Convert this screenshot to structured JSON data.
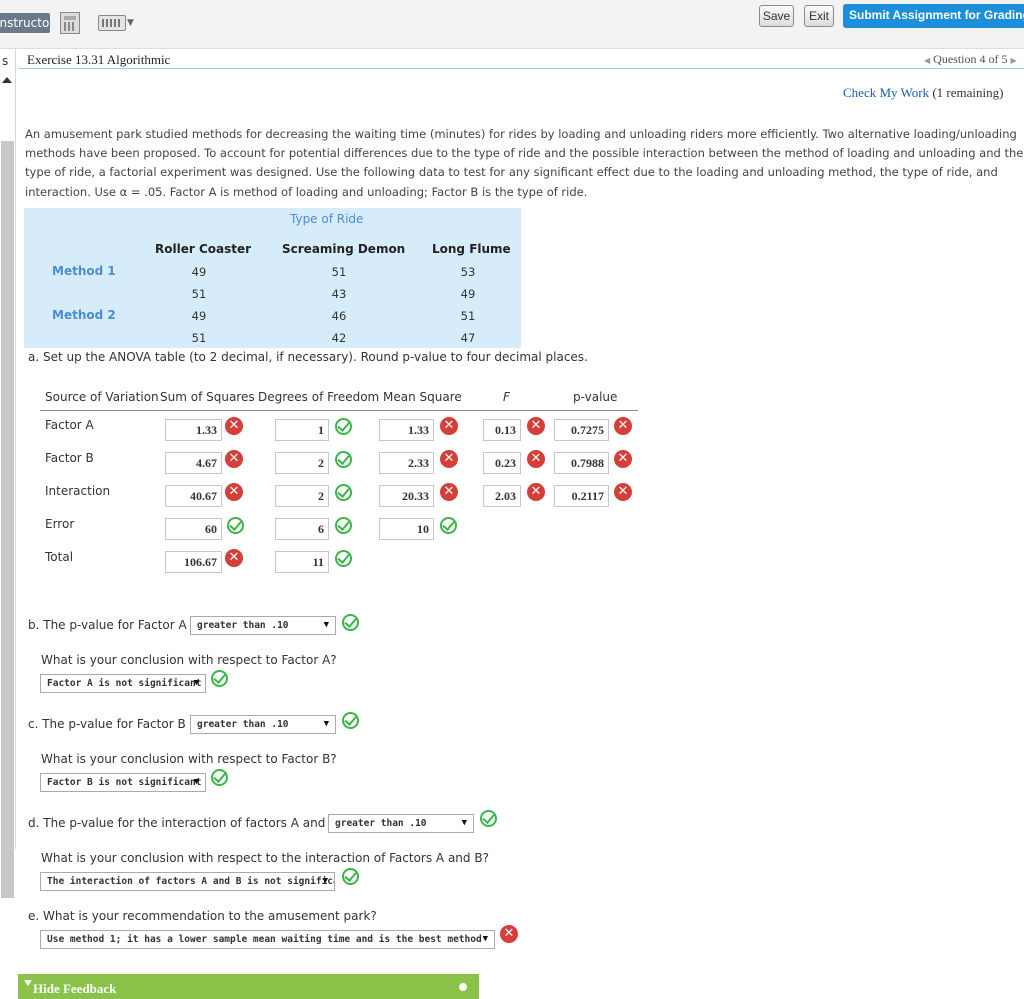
{
  "topbar": {
    "instructor_label": "Instructor",
    "save_label": "Save",
    "exit_label": "Exit",
    "submit_label": "Submit Assignment for Grading"
  },
  "header": {
    "left_strip_label": "s",
    "exercise_title": "Exercise 13.31 Algorithmic",
    "question_nav": "Question 4 of 5",
    "check_link": "Check My Work",
    "check_remaining": "(1 remaining)"
  },
  "prompt": "An amusement park studied methods for decreasing the waiting time (minutes) for rides by loading and unloading riders more efficiently. Two alternative loading/unloading methods have been proposed. To account for potential differences due to the type of ride and the possible interaction between the method of loading and unloading and the type of ride, a factorial experiment was designed. Use the following data to test for any significant effect due to the loading and unloading method, the type of ride, and interaction. Use α = .05. Factor A is method of loading and unloading; Factor B is the type of ride.",
  "data_table": {
    "caption": "Type of Ride",
    "columns": [
      "Roller Coaster",
      "Screaming Demon",
      "Long Flume"
    ],
    "method1_label": "Method 1",
    "method2_label": "Method 2",
    "rows": [
      [
        "49",
        "51",
        "53"
      ],
      [
        "51",
        "43",
        "49"
      ],
      [
        "49",
        "46",
        "51"
      ],
      [
        "51",
        "42",
        "47"
      ]
    ]
  },
  "part_a": {
    "instruction": "a. Set up the ANOVA table (to 2 decimal, if necessary). Round p-value to four decimal places.",
    "headers": [
      "Source of Variation",
      "Sum of Squares",
      "Degrees of Freedom",
      "Mean Square",
      "F",
      "p-value"
    ],
    "rows": [
      {
        "label": "Factor A",
        "ss": "1.33",
        "ss_ok": false,
        "df": "1",
        "df_ok": true,
        "ms": "1.33",
        "ms_ok": false,
        "f": "0.13",
        "f_ok": false,
        "p": "0.7275",
        "p_ok": false
      },
      {
        "label": "Factor B",
        "ss": "4.67",
        "ss_ok": false,
        "df": "2",
        "df_ok": true,
        "ms": "2.33",
        "ms_ok": false,
        "f": "0.23",
        "f_ok": false,
        "p": "0.7988",
        "p_ok": false
      },
      {
        "label": "Interaction",
        "ss": "40.67",
        "ss_ok": false,
        "df": "2",
        "df_ok": true,
        "ms": "20.33",
        "ms_ok": false,
        "f": "2.03",
        "f_ok": false,
        "p": "0.2117",
        "p_ok": false
      },
      {
        "label": "Error",
        "ss": "60",
        "ss_ok": true,
        "df": "6",
        "df_ok": true,
        "ms": "10",
        "ms_ok": true
      },
      {
        "label": "Total",
        "ss": "106.67",
        "ss_ok": false,
        "df": "11",
        "df_ok": true
      }
    ]
  },
  "part_b": {
    "question": "b. The p-value for Factor A is",
    "select": "greater than .10",
    "conclusion_q": "What is your conclusion with respect to Factor A?",
    "conclusion": "Factor A is not significant"
  },
  "part_c": {
    "question": "c. The p-value for Factor B is",
    "select": "greater than .10",
    "conclusion_q": "What is your conclusion with respect to Factor B?",
    "conclusion": "Factor B is not significant"
  },
  "part_d": {
    "question": "d. The p-value for the interaction of factors A and B is",
    "select": "greater than .10",
    "conclusion_q": "What is your conclusion with respect to the interaction of Factors A and B?",
    "conclusion": "The interaction of factors A and B is not significant"
  },
  "part_e": {
    "question": "e. What is your recommendation to the amusement park?",
    "select": "Use method 1; it has a lower sample mean waiting time and is the best method"
  },
  "feedback": {
    "label": "Hide Feedback"
  },
  "colors": {
    "accent_blue": "#1b8fd9",
    "table_bg": "#d7ecfa",
    "correct_green": "#3bb548",
    "incorrect_red": "#d43f3a",
    "feedback_green": "#8bc34a"
  }
}
